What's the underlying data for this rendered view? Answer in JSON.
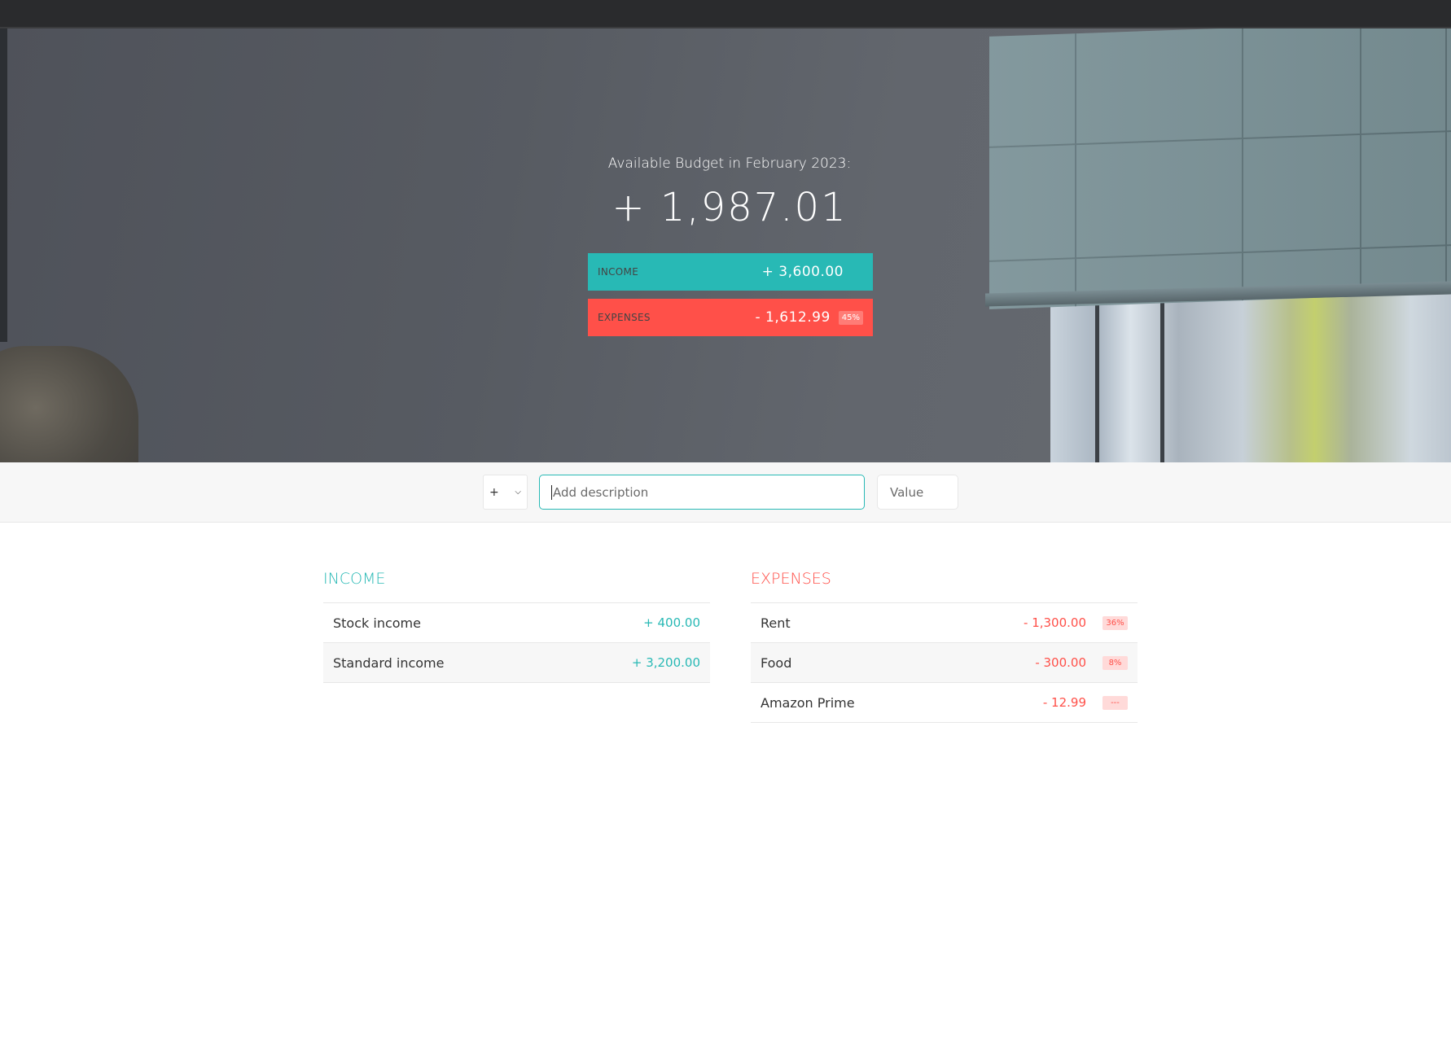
{
  "budget": {
    "title": "Available Budget in February 2023:",
    "value": "+ 1,987.01",
    "income_label": "Income",
    "income_value": "+ 3,600.00",
    "expenses_label": "Expenses",
    "expenses_value": "- 1,612.99",
    "expenses_percentage": "45%"
  },
  "add": {
    "type_selected": "+",
    "description_placeholder": "Add description",
    "value_placeholder": "Value"
  },
  "income": {
    "title": "Income",
    "items": [
      {
        "description": "Stock income",
        "value": "+ 400.00"
      },
      {
        "description": "Standard income",
        "value": "+ 3,200.00"
      }
    ]
  },
  "expenses": {
    "title": "Expenses",
    "items": [
      {
        "description": "Rent",
        "value": "- 1,300.00",
        "percentage": "36%"
      },
      {
        "description": "Food",
        "value": "- 300.00",
        "percentage": "8%"
      },
      {
        "description": "Amazon Prime",
        "value": "- 12.99",
        "percentage": "---"
      }
    ]
  },
  "colors": {
    "income": "#28b9b5",
    "expenses": "#ff5049"
  }
}
